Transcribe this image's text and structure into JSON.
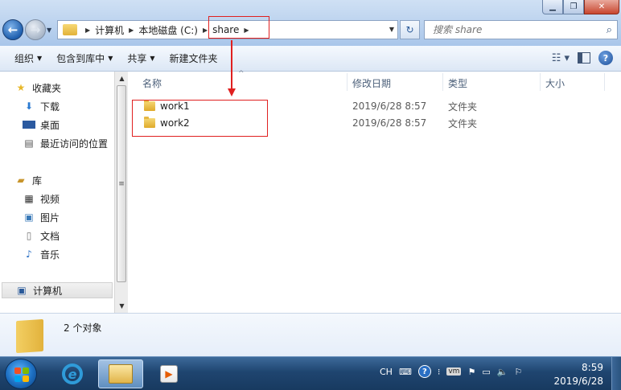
{
  "window": {
    "min_glyph": "▁",
    "max_glyph": "❐",
    "close_glyph": "✕"
  },
  "address": {
    "crumbs": [
      "计算机",
      "本地磁盘 (C:)",
      "share"
    ],
    "search_placeholder": "搜索 share"
  },
  "toolbar": {
    "organize": "组织",
    "include_library": "包含到库中",
    "share": "共享",
    "new_folder": "新建文件夹"
  },
  "navpane": {
    "favorites": "收藏夹",
    "downloads": "下载",
    "desktop": "桌面",
    "recent": "最近访问的位置",
    "libraries": "库",
    "videos": "视频",
    "pictures": "图片",
    "documents": "文档",
    "music": "音乐",
    "computer": "计算机"
  },
  "columns": {
    "name": "名称",
    "modified": "修改日期",
    "type": "类型",
    "size": "大小"
  },
  "files": [
    {
      "name": "work1",
      "modified": "2019/6/28 8:57",
      "type": "文件夹"
    },
    {
      "name": "work2",
      "modified": "2019/6/28 8:57",
      "type": "文件夹"
    }
  ],
  "details": {
    "count": "2 个对象"
  },
  "taskbar": {
    "lang": "CH",
    "clock_time": "8:59",
    "clock_date": "2019/6/28",
    "vm_label": "vm"
  },
  "colors": {
    "annotation_red": "#e02020",
    "folder_yellow": "#e2b23a"
  }
}
